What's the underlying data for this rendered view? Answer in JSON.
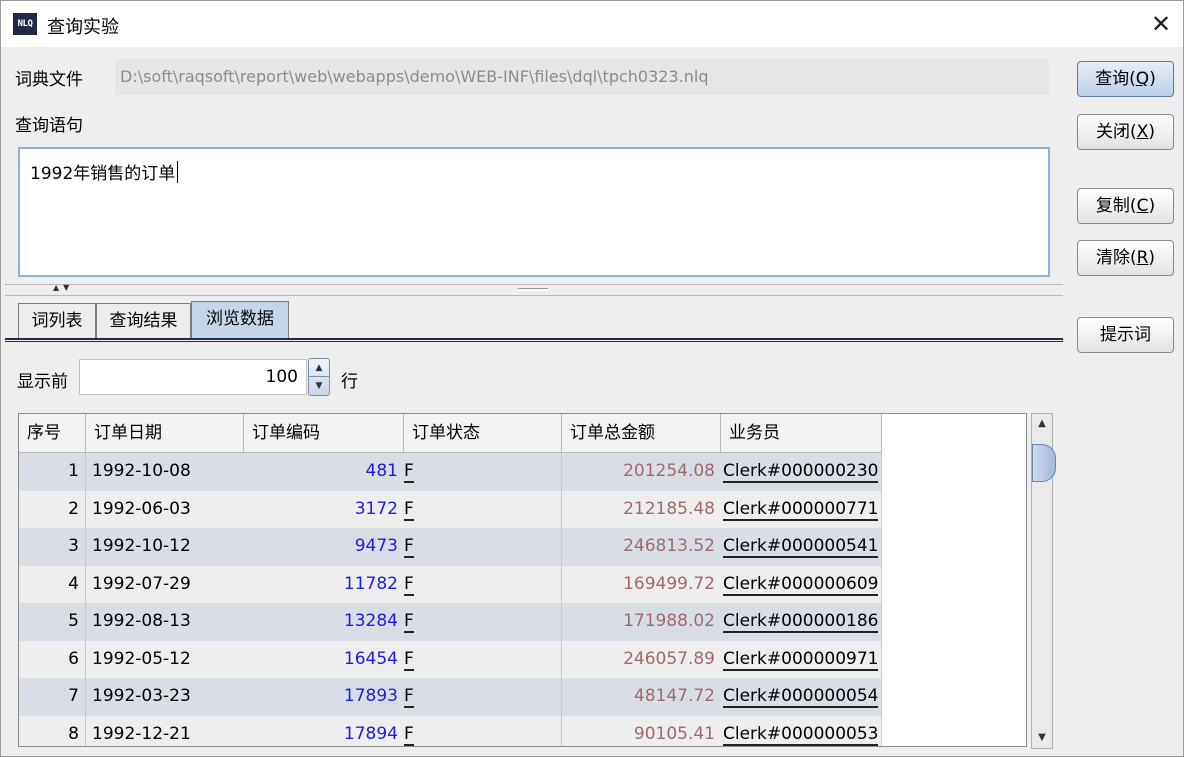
{
  "window": {
    "app_icon_text": "NLQ",
    "title": "查询实验",
    "close_glyph": "✕"
  },
  "form": {
    "dict_label": "词典文件",
    "dict_path": "D:\\soft\\raqsoft\\report\\web\\webapps\\demo\\WEB-INF\\files\\dql\\tpch0323.nlq",
    "query_label": "查询语句",
    "query_text": "1992年销售的订单"
  },
  "buttons": {
    "query": {
      "label": "查询(",
      "key": "Q",
      "end": ")"
    },
    "close": {
      "label": "关闭(",
      "key": "X",
      "end": ")"
    },
    "copy": {
      "label": "复制(",
      "key": "C",
      "end": ")"
    },
    "clear": {
      "label": "清除(",
      "key": "R",
      "end": ")"
    },
    "hint": {
      "label": "提示词"
    }
  },
  "tabs": [
    {
      "label": "词列表",
      "active": false
    },
    {
      "label": "查询结果",
      "active": false
    },
    {
      "label": "浏览数据",
      "active": true
    }
  ],
  "browse": {
    "show_prefix": "显示前",
    "row_count": "100",
    "row_suffix": "行"
  },
  "table": {
    "columns": [
      "序号",
      "订单日期",
      "订单编码",
      "订单状态",
      "订单总金额",
      "业务员"
    ],
    "rows": [
      [
        "1",
        "1992-10-08",
        "481",
        "F",
        "201254.08",
        "Clerk#000000230"
      ],
      [
        "2",
        "1992-06-03",
        "3172",
        "F",
        "212185.48",
        "Clerk#000000771"
      ],
      [
        "3",
        "1992-10-12",
        "9473",
        "F",
        "246813.52",
        "Clerk#000000541"
      ],
      [
        "4",
        "1992-07-29",
        "11782",
        "F",
        "169499.72",
        "Clerk#000000609"
      ],
      [
        "5",
        "1992-08-13",
        "13284",
        "F",
        "171988.02",
        "Clerk#000000186"
      ],
      [
        "6",
        "1992-05-12",
        "16454",
        "F",
        "246057.89",
        "Clerk#000000971"
      ],
      [
        "7",
        "1992-03-23",
        "17893",
        "F",
        "48147.72",
        "Clerk#000000054"
      ],
      [
        "8",
        "1992-12-21",
        "17894",
        "F",
        "90105.41",
        "Clerk#000000053"
      ]
    ]
  },
  "colors": {
    "code_text": "#1c1ce0",
    "amount_text": "#a06a6a",
    "row_even": "#d8dde6",
    "row_odd": "#eeeeee",
    "active_tab": "#c6d6ea"
  },
  "icons": {
    "close": "close-icon",
    "spin_up": "arrow-up-icon",
    "spin_down": "arrow-down-icon",
    "scroll_up": "scroll-up-icon",
    "scroll_down": "scroll-down-icon"
  }
}
